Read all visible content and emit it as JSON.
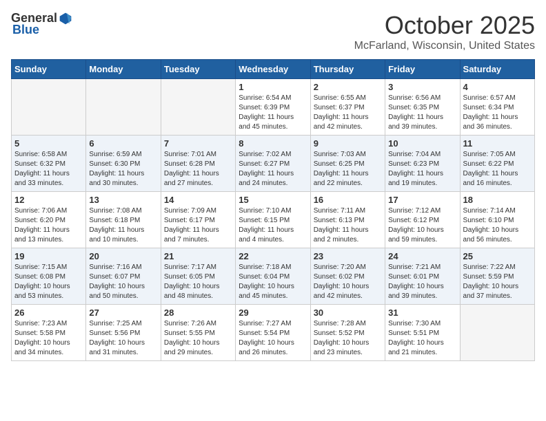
{
  "header": {
    "logo_general": "General",
    "logo_blue": "Blue",
    "month": "October 2025",
    "location": "McFarland, Wisconsin, United States"
  },
  "weekdays": [
    "Sunday",
    "Monday",
    "Tuesday",
    "Wednesday",
    "Thursday",
    "Friday",
    "Saturday"
  ],
  "weeks": [
    [
      {
        "day": "",
        "info": ""
      },
      {
        "day": "",
        "info": ""
      },
      {
        "day": "",
        "info": ""
      },
      {
        "day": "1",
        "info": "Sunrise: 6:54 AM\nSunset: 6:39 PM\nDaylight: 11 hours\nand 45 minutes."
      },
      {
        "day": "2",
        "info": "Sunrise: 6:55 AM\nSunset: 6:37 PM\nDaylight: 11 hours\nand 42 minutes."
      },
      {
        "day": "3",
        "info": "Sunrise: 6:56 AM\nSunset: 6:35 PM\nDaylight: 11 hours\nand 39 minutes."
      },
      {
        "day": "4",
        "info": "Sunrise: 6:57 AM\nSunset: 6:34 PM\nDaylight: 11 hours\nand 36 minutes."
      }
    ],
    [
      {
        "day": "5",
        "info": "Sunrise: 6:58 AM\nSunset: 6:32 PM\nDaylight: 11 hours\nand 33 minutes."
      },
      {
        "day": "6",
        "info": "Sunrise: 6:59 AM\nSunset: 6:30 PM\nDaylight: 11 hours\nand 30 minutes."
      },
      {
        "day": "7",
        "info": "Sunrise: 7:01 AM\nSunset: 6:28 PM\nDaylight: 11 hours\nand 27 minutes."
      },
      {
        "day": "8",
        "info": "Sunrise: 7:02 AM\nSunset: 6:27 PM\nDaylight: 11 hours\nand 24 minutes."
      },
      {
        "day": "9",
        "info": "Sunrise: 7:03 AM\nSunset: 6:25 PM\nDaylight: 11 hours\nand 22 minutes."
      },
      {
        "day": "10",
        "info": "Sunrise: 7:04 AM\nSunset: 6:23 PM\nDaylight: 11 hours\nand 19 minutes."
      },
      {
        "day": "11",
        "info": "Sunrise: 7:05 AM\nSunset: 6:22 PM\nDaylight: 11 hours\nand 16 minutes."
      }
    ],
    [
      {
        "day": "12",
        "info": "Sunrise: 7:06 AM\nSunset: 6:20 PM\nDaylight: 11 hours\nand 13 minutes."
      },
      {
        "day": "13",
        "info": "Sunrise: 7:08 AM\nSunset: 6:18 PM\nDaylight: 11 hours\nand 10 minutes."
      },
      {
        "day": "14",
        "info": "Sunrise: 7:09 AM\nSunset: 6:17 PM\nDaylight: 11 hours\nand 7 minutes."
      },
      {
        "day": "15",
        "info": "Sunrise: 7:10 AM\nSunset: 6:15 PM\nDaylight: 11 hours\nand 4 minutes."
      },
      {
        "day": "16",
        "info": "Sunrise: 7:11 AM\nSunset: 6:13 PM\nDaylight: 11 hours\nand 2 minutes."
      },
      {
        "day": "17",
        "info": "Sunrise: 7:12 AM\nSunset: 6:12 PM\nDaylight: 10 hours\nand 59 minutes."
      },
      {
        "day": "18",
        "info": "Sunrise: 7:14 AM\nSunset: 6:10 PM\nDaylight: 10 hours\nand 56 minutes."
      }
    ],
    [
      {
        "day": "19",
        "info": "Sunrise: 7:15 AM\nSunset: 6:08 PM\nDaylight: 10 hours\nand 53 minutes."
      },
      {
        "day": "20",
        "info": "Sunrise: 7:16 AM\nSunset: 6:07 PM\nDaylight: 10 hours\nand 50 minutes."
      },
      {
        "day": "21",
        "info": "Sunrise: 7:17 AM\nSunset: 6:05 PM\nDaylight: 10 hours\nand 48 minutes."
      },
      {
        "day": "22",
        "info": "Sunrise: 7:18 AM\nSunset: 6:04 PM\nDaylight: 10 hours\nand 45 minutes."
      },
      {
        "day": "23",
        "info": "Sunrise: 7:20 AM\nSunset: 6:02 PM\nDaylight: 10 hours\nand 42 minutes."
      },
      {
        "day": "24",
        "info": "Sunrise: 7:21 AM\nSunset: 6:01 PM\nDaylight: 10 hours\nand 39 minutes."
      },
      {
        "day": "25",
        "info": "Sunrise: 7:22 AM\nSunset: 5:59 PM\nDaylight: 10 hours\nand 37 minutes."
      }
    ],
    [
      {
        "day": "26",
        "info": "Sunrise: 7:23 AM\nSunset: 5:58 PM\nDaylight: 10 hours\nand 34 minutes."
      },
      {
        "day": "27",
        "info": "Sunrise: 7:25 AM\nSunset: 5:56 PM\nDaylight: 10 hours\nand 31 minutes."
      },
      {
        "day": "28",
        "info": "Sunrise: 7:26 AM\nSunset: 5:55 PM\nDaylight: 10 hours\nand 29 minutes."
      },
      {
        "day": "29",
        "info": "Sunrise: 7:27 AM\nSunset: 5:54 PM\nDaylight: 10 hours\nand 26 minutes."
      },
      {
        "day": "30",
        "info": "Sunrise: 7:28 AM\nSunset: 5:52 PM\nDaylight: 10 hours\nand 23 minutes."
      },
      {
        "day": "31",
        "info": "Sunrise: 7:30 AM\nSunset: 5:51 PM\nDaylight: 10 hours\nand 21 minutes."
      },
      {
        "day": "",
        "info": ""
      }
    ]
  ]
}
